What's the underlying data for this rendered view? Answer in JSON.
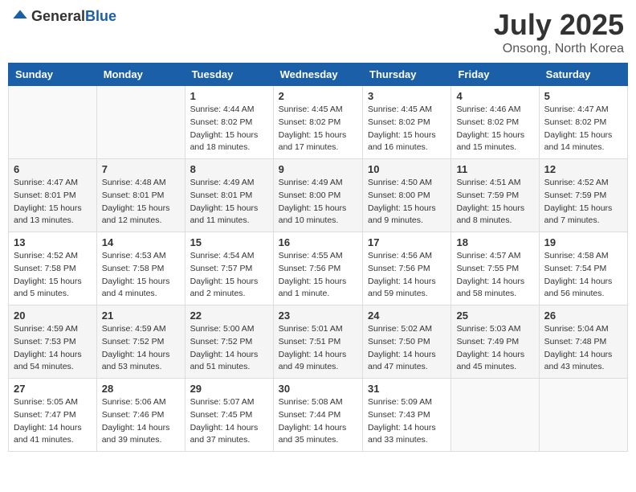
{
  "header": {
    "logo_general": "General",
    "logo_blue": "Blue",
    "title": "July 2025",
    "location": "Onsong, North Korea"
  },
  "weekdays": [
    "Sunday",
    "Monday",
    "Tuesday",
    "Wednesday",
    "Thursday",
    "Friday",
    "Saturday"
  ],
  "weeks": [
    [
      {
        "day": "",
        "sunrise": "",
        "sunset": "",
        "daylight": ""
      },
      {
        "day": "",
        "sunrise": "",
        "sunset": "",
        "daylight": ""
      },
      {
        "day": "1",
        "sunrise": "Sunrise: 4:44 AM",
        "sunset": "Sunset: 8:02 PM",
        "daylight": "Daylight: 15 hours and 18 minutes."
      },
      {
        "day": "2",
        "sunrise": "Sunrise: 4:45 AM",
        "sunset": "Sunset: 8:02 PM",
        "daylight": "Daylight: 15 hours and 17 minutes."
      },
      {
        "day": "3",
        "sunrise": "Sunrise: 4:45 AM",
        "sunset": "Sunset: 8:02 PM",
        "daylight": "Daylight: 15 hours and 16 minutes."
      },
      {
        "day": "4",
        "sunrise": "Sunrise: 4:46 AM",
        "sunset": "Sunset: 8:02 PM",
        "daylight": "Daylight: 15 hours and 15 minutes."
      },
      {
        "day": "5",
        "sunrise": "Sunrise: 4:47 AM",
        "sunset": "Sunset: 8:02 PM",
        "daylight": "Daylight: 15 hours and 14 minutes."
      }
    ],
    [
      {
        "day": "6",
        "sunrise": "Sunrise: 4:47 AM",
        "sunset": "Sunset: 8:01 PM",
        "daylight": "Daylight: 15 hours and 13 minutes."
      },
      {
        "day": "7",
        "sunrise": "Sunrise: 4:48 AM",
        "sunset": "Sunset: 8:01 PM",
        "daylight": "Daylight: 15 hours and 12 minutes."
      },
      {
        "day": "8",
        "sunrise": "Sunrise: 4:49 AM",
        "sunset": "Sunset: 8:01 PM",
        "daylight": "Daylight: 15 hours and 11 minutes."
      },
      {
        "day": "9",
        "sunrise": "Sunrise: 4:49 AM",
        "sunset": "Sunset: 8:00 PM",
        "daylight": "Daylight: 15 hours and 10 minutes."
      },
      {
        "day": "10",
        "sunrise": "Sunrise: 4:50 AM",
        "sunset": "Sunset: 8:00 PM",
        "daylight": "Daylight: 15 hours and 9 minutes."
      },
      {
        "day": "11",
        "sunrise": "Sunrise: 4:51 AM",
        "sunset": "Sunset: 7:59 PM",
        "daylight": "Daylight: 15 hours and 8 minutes."
      },
      {
        "day": "12",
        "sunrise": "Sunrise: 4:52 AM",
        "sunset": "Sunset: 7:59 PM",
        "daylight": "Daylight: 15 hours and 7 minutes."
      }
    ],
    [
      {
        "day": "13",
        "sunrise": "Sunrise: 4:52 AM",
        "sunset": "Sunset: 7:58 PM",
        "daylight": "Daylight: 15 hours and 5 minutes."
      },
      {
        "day": "14",
        "sunrise": "Sunrise: 4:53 AM",
        "sunset": "Sunset: 7:58 PM",
        "daylight": "Daylight: 15 hours and 4 minutes."
      },
      {
        "day": "15",
        "sunrise": "Sunrise: 4:54 AM",
        "sunset": "Sunset: 7:57 PM",
        "daylight": "Daylight: 15 hours and 2 minutes."
      },
      {
        "day": "16",
        "sunrise": "Sunrise: 4:55 AM",
        "sunset": "Sunset: 7:56 PM",
        "daylight": "Daylight: 15 hours and 1 minute."
      },
      {
        "day": "17",
        "sunrise": "Sunrise: 4:56 AM",
        "sunset": "Sunset: 7:56 PM",
        "daylight": "Daylight: 14 hours and 59 minutes."
      },
      {
        "day": "18",
        "sunrise": "Sunrise: 4:57 AM",
        "sunset": "Sunset: 7:55 PM",
        "daylight": "Daylight: 14 hours and 58 minutes."
      },
      {
        "day": "19",
        "sunrise": "Sunrise: 4:58 AM",
        "sunset": "Sunset: 7:54 PM",
        "daylight": "Daylight: 14 hours and 56 minutes."
      }
    ],
    [
      {
        "day": "20",
        "sunrise": "Sunrise: 4:59 AM",
        "sunset": "Sunset: 7:53 PM",
        "daylight": "Daylight: 14 hours and 54 minutes."
      },
      {
        "day": "21",
        "sunrise": "Sunrise: 4:59 AM",
        "sunset": "Sunset: 7:52 PM",
        "daylight": "Daylight: 14 hours and 53 minutes."
      },
      {
        "day": "22",
        "sunrise": "Sunrise: 5:00 AM",
        "sunset": "Sunset: 7:52 PM",
        "daylight": "Daylight: 14 hours and 51 minutes."
      },
      {
        "day": "23",
        "sunrise": "Sunrise: 5:01 AM",
        "sunset": "Sunset: 7:51 PM",
        "daylight": "Daylight: 14 hours and 49 minutes."
      },
      {
        "day": "24",
        "sunrise": "Sunrise: 5:02 AM",
        "sunset": "Sunset: 7:50 PM",
        "daylight": "Daylight: 14 hours and 47 minutes."
      },
      {
        "day": "25",
        "sunrise": "Sunrise: 5:03 AM",
        "sunset": "Sunset: 7:49 PM",
        "daylight": "Daylight: 14 hours and 45 minutes."
      },
      {
        "day": "26",
        "sunrise": "Sunrise: 5:04 AM",
        "sunset": "Sunset: 7:48 PM",
        "daylight": "Daylight: 14 hours and 43 minutes."
      }
    ],
    [
      {
        "day": "27",
        "sunrise": "Sunrise: 5:05 AM",
        "sunset": "Sunset: 7:47 PM",
        "daylight": "Daylight: 14 hours and 41 minutes."
      },
      {
        "day": "28",
        "sunrise": "Sunrise: 5:06 AM",
        "sunset": "Sunset: 7:46 PM",
        "daylight": "Daylight: 14 hours and 39 minutes."
      },
      {
        "day": "29",
        "sunrise": "Sunrise: 5:07 AM",
        "sunset": "Sunset: 7:45 PM",
        "daylight": "Daylight: 14 hours and 37 minutes."
      },
      {
        "day": "30",
        "sunrise": "Sunrise: 5:08 AM",
        "sunset": "Sunset: 7:44 PM",
        "daylight": "Daylight: 14 hours and 35 minutes."
      },
      {
        "day": "31",
        "sunrise": "Sunrise: 5:09 AM",
        "sunset": "Sunset: 7:43 PM",
        "daylight": "Daylight: 14 hours and 33 minutes."
      },
      {
        "day": "",
        "sunrise": "",
        "sunset": "",
        "daylight": ""
      },
      {
        "day": "",
        "sunrise": "",
        "sunset": "",
        "daylight": ""
      }
    ]
  ]
}
